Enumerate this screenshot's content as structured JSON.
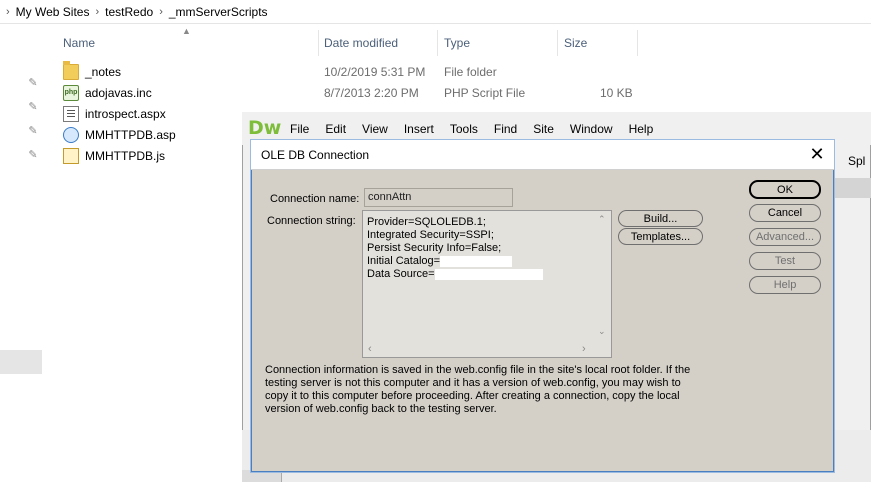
{
  "explorer": {
    "breadcrumb": [
      "My Web Sites",
      "testRedo",
      "_mmServerScripts"
    ],
    "columns": {
      "name": "Name",
      "date": "Date modified",
      "type": "Type",
      "size": "Size"
    },
    "files": [
      {
        "name": "_notes",
        "date": "10/2/2019 5:31 PM",
        "type": "File folder",
        "size": "",
        "icon": "folder-icon"
      },
      {
        "name": "adojavas.inc",
        "date": "8/7/2013 2:20 PM",
        "type": "PHP Script File",
        "size": "10 KB",
        "icon": "php-file-icon"
      },
      {
        "name": "introspect.aspx",
        "date": "",
        "type": "",
        "size": "",
        "icon": "document-icon"
      },
      {
        "name": "MMHTTPDB.asp",
        "date": "",
        "type": "",
        "size": "",
        "icon": "asp-file-icon"
      },
      {
        "name": "MMHTTPDB.js",
        "date": "",
        "type": "",
        "size": "",
        "icon": "js-file-icon"
      }
    ]
  },
  "dreamweaver": {
    "logo": "Dw",
    "menu": [
      "File",
      "Edit",
      "View",
      "Insert",
      "Tools",
      "Find",
      "Site",
      "Window",
      "Help"
    ],
    "partial_label": "Spl"
  },
  "dialog": {
    "title": "OLE DB Connection",
    "connection_name_label": "Connection name:",
    "connection_name_value": "connAttn",
    "connection_string_label": "Connection string:",
    "connection_string_lines": [
      "Provider=SQLOLEDB.1;",
      "Integrated Security=SSPI;",
      "Persist Security Info=False;",
      "Initial Catalog=",
      "Data Source="
    ],
    "buttons": {
      "build": "Build...",
      "templates": "Templates...",
      "ok": "OK",
      "cancel": "Cancel",
      "advanced": "Advanced...",
      "test": "Test",
      "help": "Help"
    },
    "info_text": "Connection information is saved in the web.config file in the site's local root folder. If the testing server is not this computer and it has a version of web.config, you may wish to copy it to this computer before proceeding. After creating a connection, copy the local version of web.config back to the testing server."
  }
}
